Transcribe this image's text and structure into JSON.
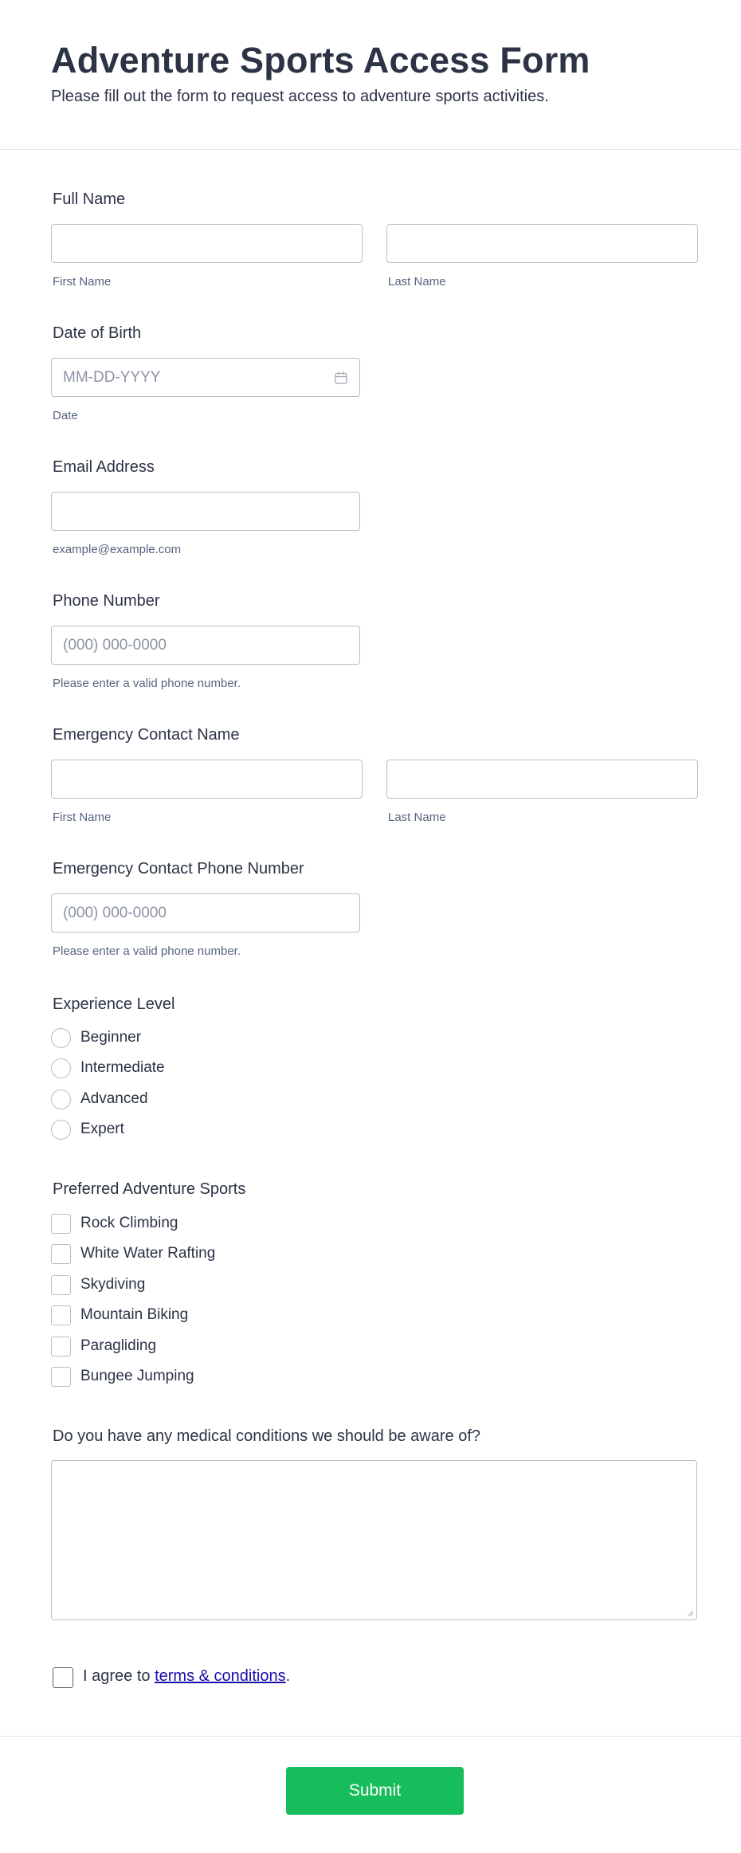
{
  "header": {
    "title": "Adventure Sports Access Form",
    "subtitle": "Please fill out the form to request access to adventure sports activities."
  },
  "full_name": {
    "label": "Full Name",
    "first_sublabel": "First Name",
    "last_sublabel": "Last Name",
    "first_value": "",
    "last_value": ""
  },
  "dob": {
    "label": "Date of Birth",
    "placeholder": "MM-DD-YYYY",
    "sublabel": "Date",
    "icon": "calendar-icon"
  },
  "email": {
    "label": "Email Address",
    "sublabel": "example@example.com",
    "value": ""
  },
  "phone": {
    "label": "Phone Number",
    "placeholder": "(000) 000-0000",
    "sublabel": "Please enter a valid phone number."
  },
  "emergency_name": {
    "label": "Emergency Contact Name",
    "first_sublabel": "First Name",
    "last_sublabel": "Last Name"
  },
  "emergency_phone": {
    "label": "Emergency Contact Phone Number",
    "placeholder": "(000) 000-0000",
    "sublabel": "Please enter a valid phone number."
  },
  "experience": {
    "label": "Experience Level",
    "options": [
      "Beginner",
      "Intermediate",
      "Advanced",
      "Expert"
    ]
  },
  "sports": {
    "label": "Preferred Adventure Sports",
    "options": [
      "Rock Climbing",
      "White Water Rafting",
      "Skydiving",
      "Mountain Biking",
      "Paragliding",
      "Bungee Jumping"
    ]
  },
  "medical": {
    "label": "Do you have any medical conditions we should be aware of?",
    "value": ""
  },
  "terms": {
    "prefix": "I agree to ",
    "link": "terms & conditions",
    "suffix": "."
  },
  "submit": {
    "label": "Submit",
    "color": "#18bd5b"
  }
}
